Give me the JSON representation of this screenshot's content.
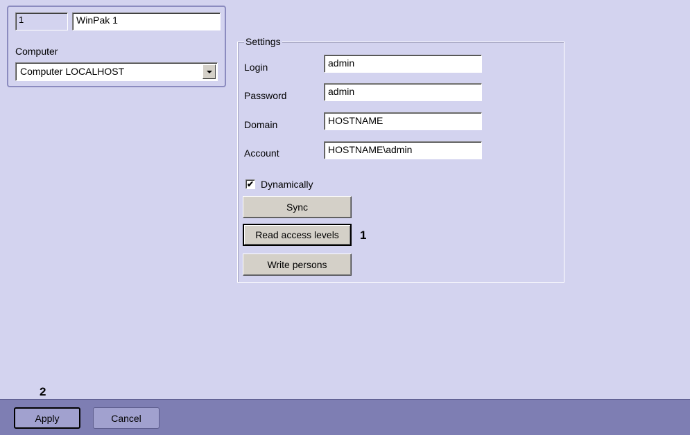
{
  "object": {
    "id": "1",
    "name": "WinPak 1",
    "computer_label": "Computer",
    "computer_value": "Computer LOCALHOST"
  },
  "settings": {
    "legend": "Settings",
    "login_label": "Login",
    "login_value": "admin",
    "password_label": "Password",
    "password_value": "admin",
    "domain_label": "Domain",
    "domain_value": "HOSTNAME",
    "account_label": "Account",
    "account_value": "HOSTNAME\\admin",
    "dynamically_label": "Dynamically",
    "dynamically_checked": true,
    "sync_label": "Sync",
    "read_access_label": "Read access levels",
    "write_persons_label": "Write persons"
  },
  "markers": {
    "one": "1",
    "two": "2"
  },
  "footer": {
    "apply_label": "Apply",
    "cancel_label": "Cancel"
  }
}
